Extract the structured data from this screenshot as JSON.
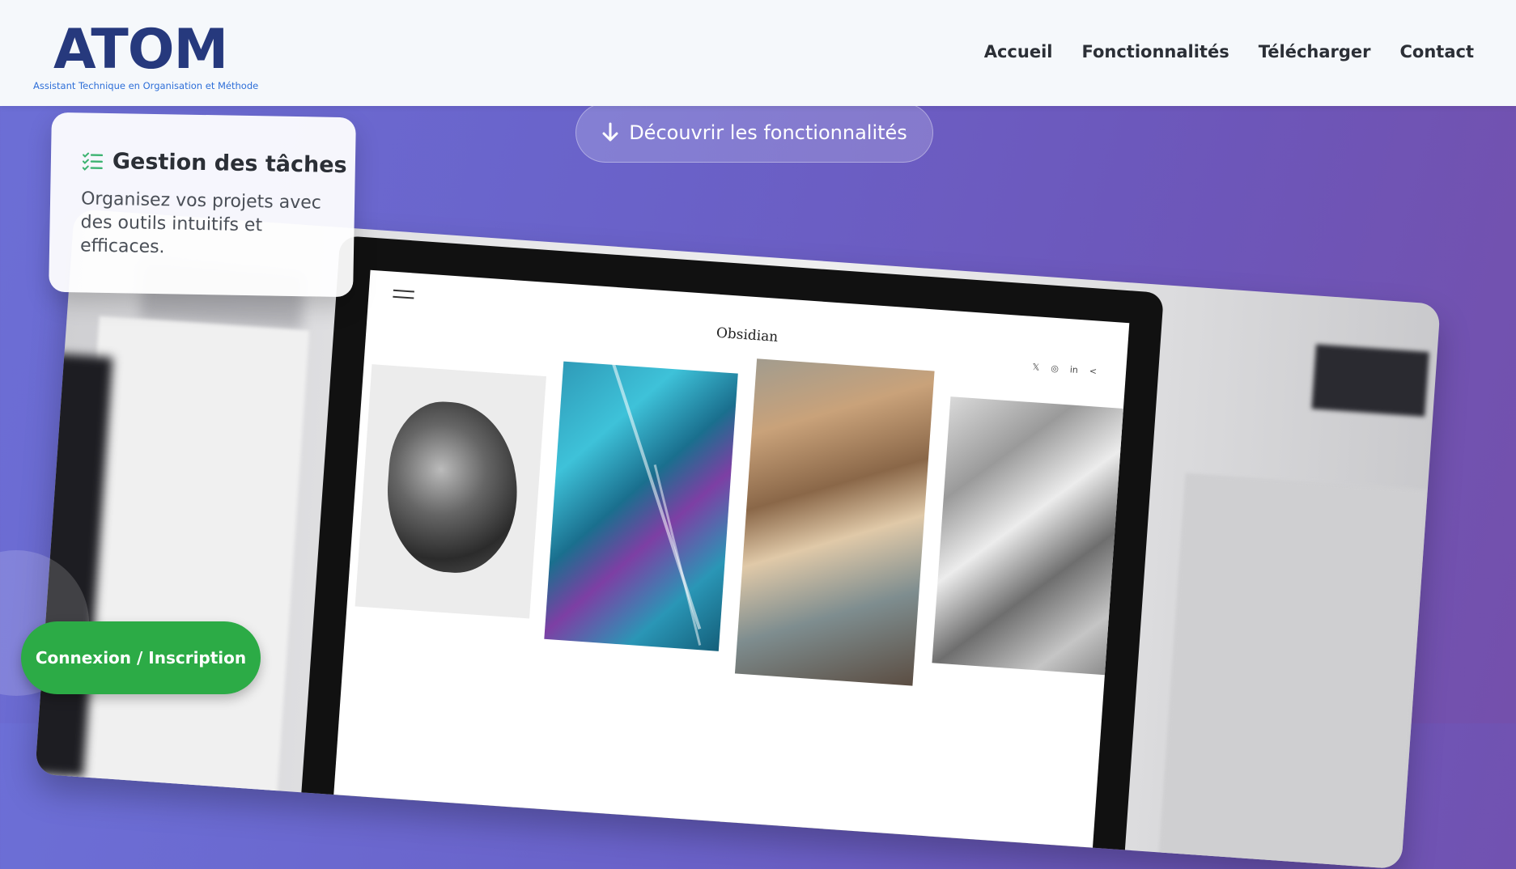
{
  "header": {
    "logo_text": "ATOM",
    "logo_subtitle": "Assistant Technique en Organisation et Méthode",
    "nav": [
      {
        "label": "Accueil"
      },
      {
        "label": "Fonctionnalités"
      },
      {
        "label": "Télécharger"
      },
      {
        "label": "Contact"
      }
    ]
  },
  "hero": {
    "discover_button": "Découvrir les fonctionnalités",
    "discover_icon": "arrow-down-icon"
  },
  "feature_card": {
    "icon": "task-list-icon",
    "title": "Gestion des tâches",
    "description": "Organisez vos projets avec des outils intuitifs et efficaces."
  },
  "laptop_site": {
    "title": "Obsidian",
    "socials": [
      "𝕏",
      "◎",
      "in",
      "<"
    ]
  },
  "auth": {
    "button_label": "Connexion / Inscription"
  },
  "colors": {
    "brand": "#26397d",
    "accent_green": "#2cab46",
    "gradient_start": "#6c6fd6",
    "gradient_end": "#7450ac"
  }
}
